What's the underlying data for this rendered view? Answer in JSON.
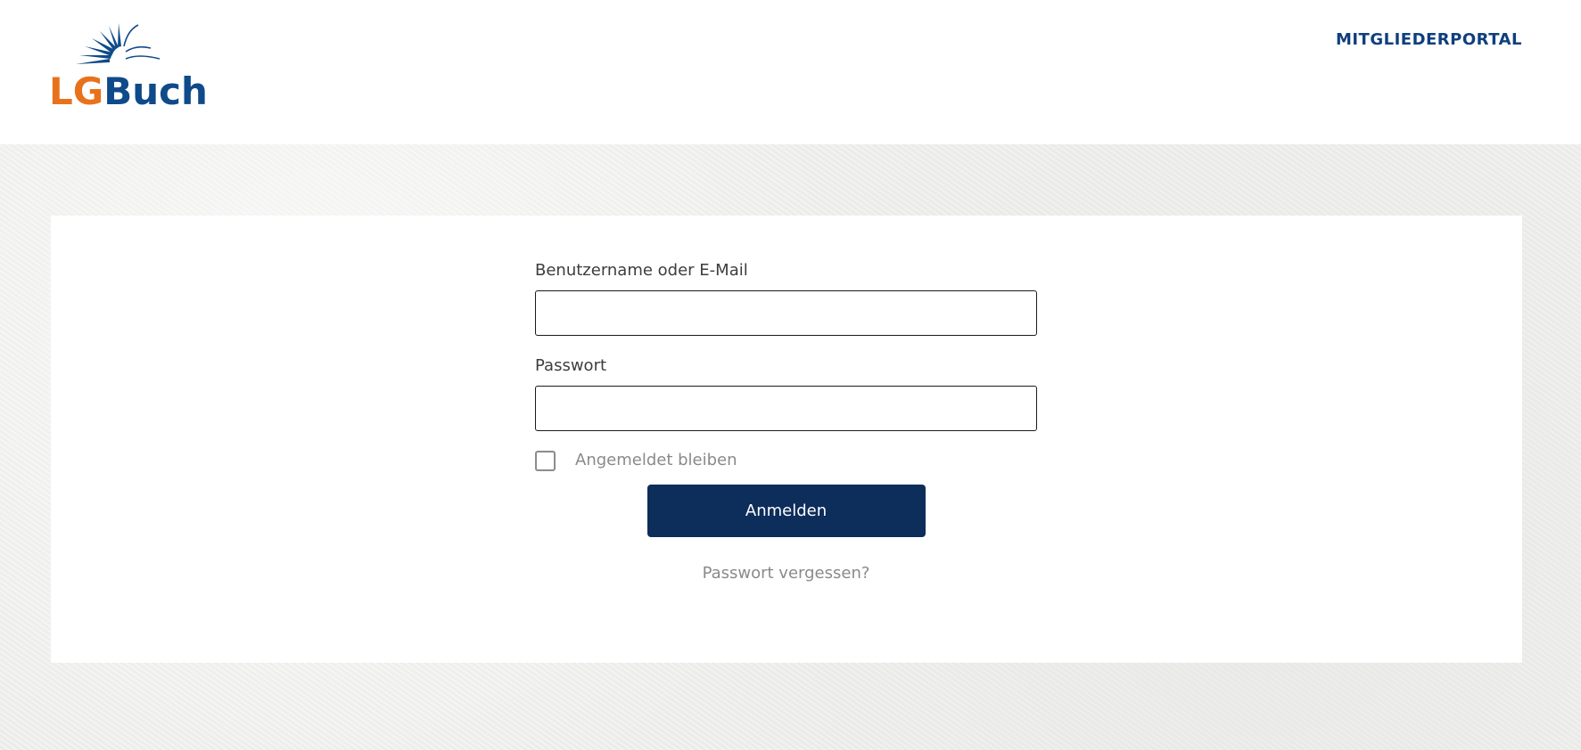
{
  "header": {
    "logo": {
      "part1": "LG",
      "part2": "Buch",
      "primary_color": "#e8721c",
      "secondary_color": "#0f4a8a"
    },
    "portal_link_label": "MITGLIEDERPORTAL"
  },
  "login": {
    "username_label": "Benutzername oder E-Mail",
    "username_value": "",
    "password_label": "Passwort",
    "password_value": "",
    "remember_label": "Angemeldet bleiben",
    "remember_checked": false,
    "submit_label": "Anmelden",
    "forgot_label": "Passwort vergessen?",
    "button_color": "#0d2d5b"
  }
}
